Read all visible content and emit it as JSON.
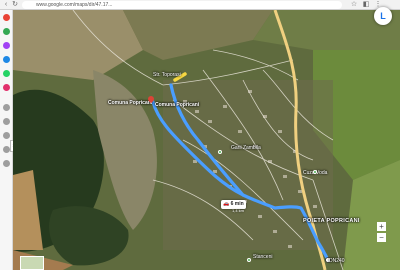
{
  "browser": {
    "url": "www.google.com/maps/dir/47.17..."
  },
  "map": {
    "labels": {
      "street": "Str. Toporasi",
      "commune_upper": "Comuna Popricani",
      "commune_lower": "Comuna Popricani",
      "village_center": "Garii Zambila",
      "village_right": "Cuza Voda",
      "village_main": "POIETA POPRICANI",
      "road_label": "DN240",
      "place_bottom": "Stanceni"
    },
    "route": {
      "time": "6 min",
      "distance": "1,4 km"
    }
  },
  "controls": {
    "account_initial": "L",
    "zoom_in": "+",
    "zoom_out": "−"
  },
  "colors": {
    "route": "#4a9eff",
    "highway": "#f0d080"
  }
}
